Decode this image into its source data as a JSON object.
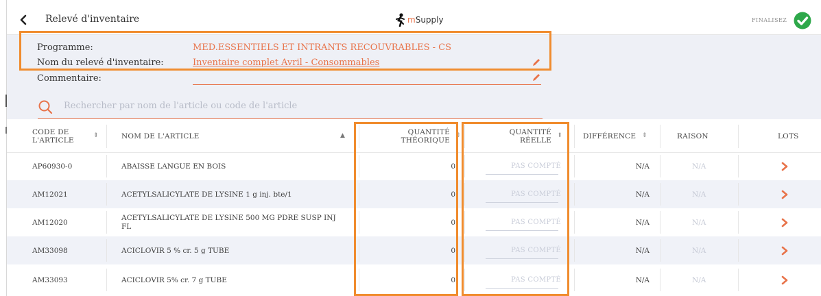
{
  "nav": {
    "title": "Relevé d'inventaire",
    "logo_text": "Supply",
    "logo_m": "m",
    "finalise_label": "FINALISEZ"
  },
  "header": {
    "program_label": "Programme:",
    "program_value": "MED.ESSENTIELS ET INTRANTS RECOUVRABLES - CS",
    "name_label": "Nom du relevé d'inventaire:",
    "name_value": "Inventaire complet Avril - Consommables",
    "comment_label": "Commentaire:",
    "comment_value": ""
  },
  "search": {
    "placeholder": "Rechercher par nom de l'article ou code de l'article"
  },
  "columns": {
    "code": "CODE DE L'ARTICLE",
    "code_l1": "CODE DE",
    "code_l2": "L'ARTICLE",
    "name": "NOM DE L'ARTICLE",
    "theo_l1": "QUANTITÉ",
    "theo_l2": "THÉORIQUE",
    "real_l1": "QUANTITÉ",
    "real_l2": "RÉELLE",
    "diff": "DIFFÉRENCE",
    "reason": "RAISON",
    "lots": "LOTS"
  },
  "rows": [
    {
      "code": "AP60930-0",
      "name": "ABAISSE LANGUE EN BOIS",
      "theoretical": "0",
      "counted": "PAS COMPTÉ",
      "difference": "N/A",
      "reason": "N/A"
    },
    {
      "code": "AM12021",
      "name": "ACETYLSALICYLATE DE LYSINE 1 g inj. bte/1",
      "theoretical": "0",
      "counted": "PAS COMPTÉ",
      "difference": "N/A",
      "reason": "N/A"
    },
    {
      "code": "AM12020",
      "name": "ACETYLSALICYLATE DE LYSINE 500 MG PDRE SUSP INJ FL",
      "theoretical": "0",
      "counted": "PAS COMPTÉ",
      "difference": "N/A",
      "reason": "N/A"
    },
    {
      "code": "AM33098",
      "name": "ACICLOVIR 5 % cr. 5 g TUBE",
      "theoretical": "0",
      "counted": "PAS COMPTÉ",
      "difference": "N/A",
      "reason": "N/A"
    },
    {
      "code": "AM33093",
      "name": "ACICLOVIR 5% cr. 7 g TUBE",
      "theoretical": "0",
      "counted": "PAS COMPTÉ",
      "difference": "N/A",
      "reason": "N/A"
    }
  ],
  "colors": {
    "accent": "#e8734a",
    "highlight": "#f08c2e",
    "success": "#2ea84a",
    "panel": "#eef0f6"
  }
}
